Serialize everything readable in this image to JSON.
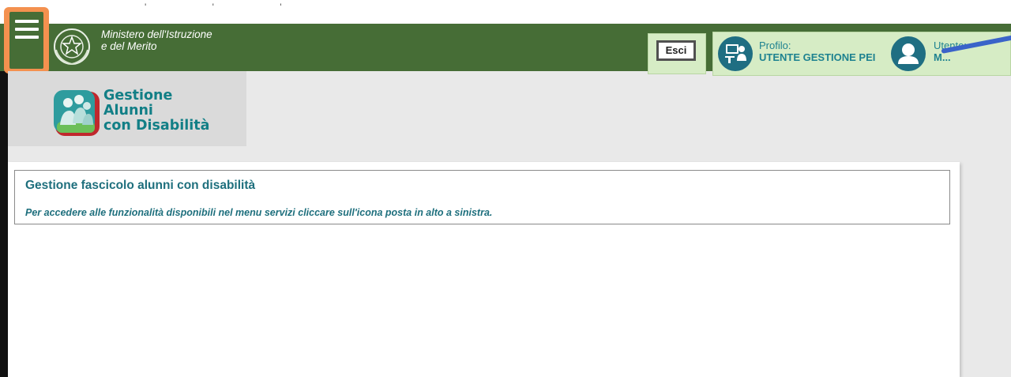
{
  "topstrip": {
    "dots": "' ' '"
  },
  "header": {
    "menu_icon": "hamburger-menu-icon",
    "emblem_icon": "italian-republic-emblem",
    "ministry_line1": "Ministero dell'Istruzione",
    "ministry_line2": "e del Merito",
    "exit_label": "Esci",
    "profile": {
      "label": "Profilo:",
      "value": "UTENTE GESTIONE PEI"
    },
    "user": {
      "label": "Utente:",
      "value": "M..."
    },
    "colors": {
      "header_bg": "#466d36",
      "menu_highlight": "#f4914f",
      "panel_bg": "#d6ecc5",
      "accent_text": "#1e8290"
    }
  },
  "app": {
    "logo_icon": "students-group-logo",
    "title_line1": "Gestione",
    "title_line2": "Alunni",
    "title_line3": "con Disabilità"
  },
  "main": {
    "heading": "Gestione fascicolo alunni con disabilità",
    "instructions": "Per accedere alle funzionalità disponibili nel menu servizi cliccare sull'icona posta in alto a sinistra."
  }
}
